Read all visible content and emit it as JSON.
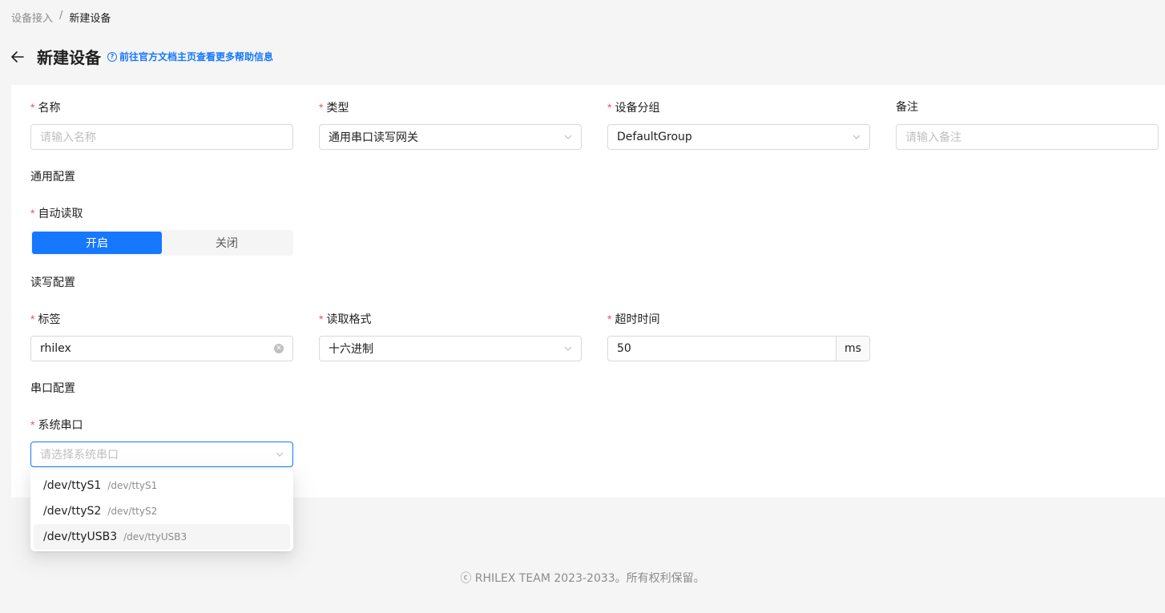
{
  "breadcrumb": {
    "parent": "设备接入",
    "separator": "/",
    "current": "新建设备"
  },
  "header": {
    "title": "新建设备",
    "help_icon": "?",
    "help_text": "前往官方文档主页查看更多帮助信息"
  },
  "form": {
    "name": {
      "label": "名称",
      "placeholder": "请输入名称"
    },
    "type": {
      "label": "类型",
      "value": "通用串口读写网关"
    },
    "group": {
      "label": "设备分组",
      "value": "DefaultGroup"
    },
    "remark": {
      "label": "备注",
      "placeholder": "请输入备注"
    },
    "common_section": "通用配置",
    "auto_read": {
      "label": "自动读取",
      "on": "开启",
      "off": "关闭",
      "selected": "开启"
    },
    "rw_section": "读写配置",
    "tag": {
      "label": "标签",
      "value": "rhilex"
    },
    "read_format": {
      "label": "读取格式",
      "value": "十六进制"
    },
    "timeout": {
      "label": "超时时间",
      "value": "50",
      "unit": "ms"
    },
    "serial_section": "串口配置",
    "serial_port": {
      "label": "系统串口",
      "placeholder": "请选择系统串口"
    }
  },
  "required_mark": "*",
  "dropdown": {
    "options": [
      {
        "label": "/dev/ttyS1",
        "desc": "/dev/ttyS1"
      },
      {
        "label": "/dev/ttyS2",
        "desc": "/dev/ttyS2"
      },
      {
        "label": "/dev/ttyUSB3",
        "desc": "/dev/ttyUSB3"
      }
    ],
    "hovered_index": 2
  },
  "footer": {
    "copyright": "ⓒ RHILEX TEAM 2023-2033。所有权利保留。"
  },
  "colors": {
    "primary": "#1677ff",
    "required": "#ff4d4f"
  },
  "icons": {
    "back": "arrow-left-icon",
    "help": "question-circle-icon",
    "select": "chevron-down-icon",
    "clear": "close-circle-icon"
  }
}
